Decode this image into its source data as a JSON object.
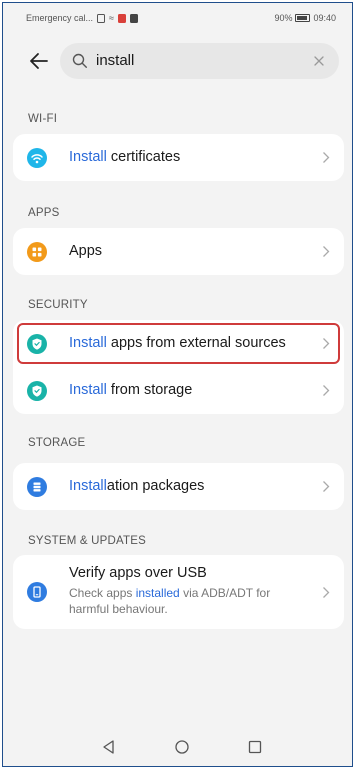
{
  "status": {
    "carrier": "Emergency cal...",
    "battery": "90%",
    "time": "09:40",
    "battery_level": 0.9
  },
  "search": {
    "query": "install"
  },
  "sections": [
    {
      "header": "WI-FI",
      "items": [
        {
          "highlight": "Install",
          "rest": " certificates",
          "icon": "wifi-icon",
          "icon_color": "#1fb6e9"
        }
      ]
    },
    {
      "header": "APPS",
      "items": [
        {
          "highlight": "",
          "rest": "Apps",
          "icon": "apps-grid-icon",
          "icon_color": "#f29a1a"
        }
      ]
    },
    {
      "header": "SECURITY",
      "items": [
        {
          "highlight": "Install",
          "rest": " apps from external sources",
          "icon": "shield-icon",
          "icon_color": "#19b3a8"
        },
        {
          "highlight": "Install",
          "rest": " from storage",
          "icon": "shield-icon",
          "icon_color": "#19b3a8"
        }
      ]
    },
    {
      "header": "STORAGE",
      "items": [
        {
          "highlight": "Install",
          "rest": "ation packages",
          "icon": "storage-icon",
          "icon_color": "#2f7ce0"
        }
      ]
    },
    {
      "header": "SYSTEM & UPDATES",
      "items": [
        {
          "title": "Verify apps over USB",
          "desc_before": "Check apps ",
          "desc_highlight": "installed",
          "desc_after": " via ADB/ADT for harmful behaviour.",
          "icon": "usb-phone-icon",
          "icon_color": "#2f7ce0"
        }
      ]
    }
  ],
  "colors": {
    "accent": "#2a6ad9",
    "highlight_border": "#cf3b3b",
    "background": "#f3f3f3"
  }
}
